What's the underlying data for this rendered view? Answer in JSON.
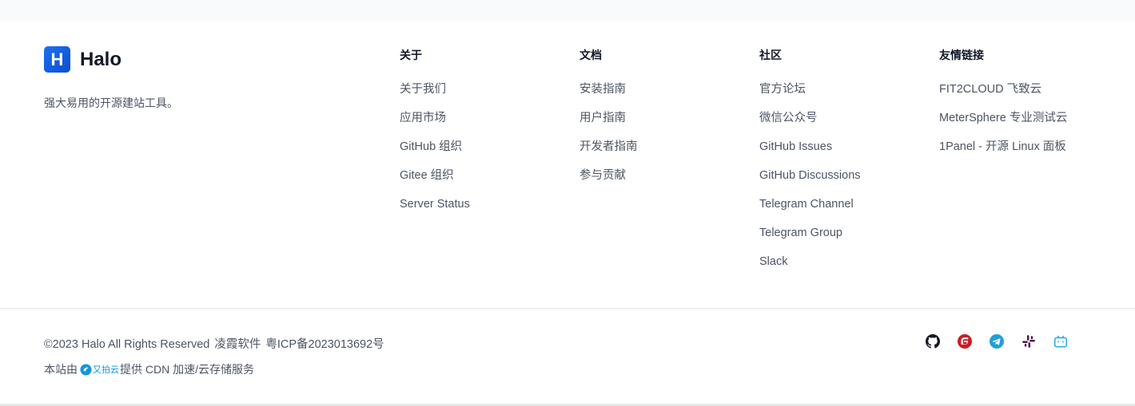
{
  "brand": {
    "logo_letter": "H",
    "name": "Halo",
    "tagline": "强大易用的开源建站工具。"
  },
  "columns": [
    {
      "title": "关于",
      "links": [
        "关于我们",
        "应用市场",
        "GitHub 组织",
        "Gitee 组织",
        "Server Status"
      ]
    },
    {
      "title": "文档",
      "links": [
        "安装指南",
        "用户指南",
        "开发者指南",
        "参与贡献"
      ]
    },
    {
      "title": "社区",
      "links": [
        "官方论坛",
        "微信公众号",
        "GitHub Issues",
        "GitHub Discussions",
        "Telegram Channel",
        "Telegram Group",
        "Slack"
      ]
    },
    {
      "title": "友情链接",
      "links": [
        "FIT2CLOUD 飞致云",
        "MeterSphere 专业测试云",
        "1Panel - 开源 Linux 面板"
      ]
    }
  ],
  "footer": {
    "copyright": "©2023 Halo All Rights Reserved",
    "company": "凌霞软件",
    "icp": "粤ICP备2023013692号",
    "cdn_prefix": "本站由",
    "cdn_provider": "又拍云",
    "cdn_suffix": "提供 CDN 加速/云存储服务"
  },
  "socials": [
    {
      "icon": "github-icon",
      "color": "#111827"
    },
    {
      "icon": "gitee-icon",
      "color": "#c71d23"
    },
    {
      "icon": "telegram-icon",
      "color": "#229ed9"
    },
    {
      "icon": "slack-icon",
      "color": "#4a154b"
    },
    {
      "icon": "bilibili-icon",
      "color": "#23ade5"
    }
  ]
}
